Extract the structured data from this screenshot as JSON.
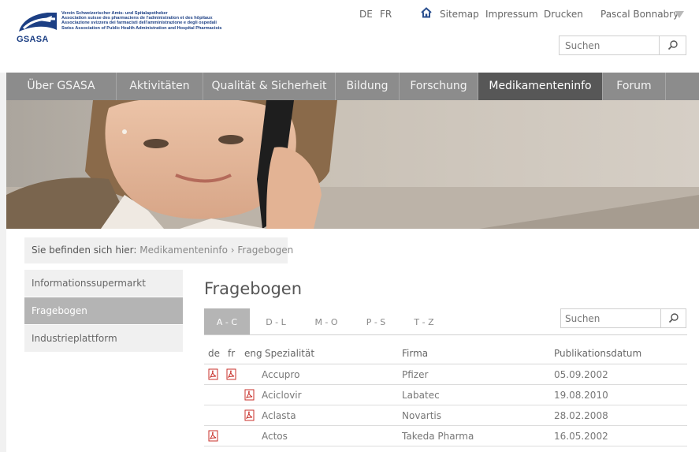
{
  "logo": {
    "lines": [
      "Verein Schweizerischer Amts- und Spitalapotheker",
      "Association suisse des pharmaciens de l'administration et des hôpitaux",
      "Associazione svizzera dei farmacisti dell'amministrazione e degli ospedali",
      "Swiss Association of Public Health Administration and Hospital Pharmacists"
    ],
    "acronym": "GSASA"
  },
  "header": {
    "lang_de": "DE",
    "lang_fr": "FR",
    "home_icon": "home-icon",
    "sitemap": "Sitemap",
    "impressum": "Impressum",
    "drucken": "Drucken",
    "user": "Pascal Bonnabry",
    "search_placeholder": "Suchen"
  },
  "nav": {
    "items": [
      "Über GSASA",
      "Aktivitäten",
      "Qualität & Sicherheit",
      "Bildung",
      "Forschung",
      "Medikamenteninfo",
      "Forum"
    ],
    "active": "Medikamenteninfo"
  },
  "breadcrumb": {
    "prefix": "Sie befinden sich hier:",
    "items": [
      "Medikamenteninfo",
      "Fragebogen"
    ],
    "separator": "›"
  },
  "sidebar": {
    "items": [
      "Informationssupermarkt",
      "Fragebogen",
      "Industrieplattform"
    ],
    "active": "Fragebogen"
  },
  "main": {
    "title": "Fragebogen",
    "tabs": [
      "A - C",
      "D - L",
      "M - O",
      "P - S",
      "T - Z"
    ],
    "active_tab": "A - C",
    "search_placeholder": "Suchen",
    "columns": [
      "de",
      "fr",
      "eng",
      "Spezialität",
      "Firma",
      "Publikationsdatum"
    ],
    "rows": [
      {
        "de": true,
        "fr": true,
        "eng": false,
        "name": "Accupro",
        "firma": "Pfizer",
        "date": "05.09.2002"
      },
      {
        "de": false,
        "fr": false,
        "eng": true,
        "name": "Aciclovir",
        "firma": "Labatec",
        "date": "19.08.2010"
      },
      {
        "de": false,
        "fr": false,
        "eng": true,
        "name": "Aclasta",
        "firma": "Novartis",
        "date": "28.02.2008"
      },
      {
        "de": true,
        "fr": false,
        "eng": false,
        "name": "Actos",
        "firma": "Takeda Pharma",
        "date": "16.05.2002"
      }
    ]
  },
  "colors": {
    "nav_bg": "#8c8c8c",
    "nav_active": "#575757",
    "brand_blue": "#1c3f84",
    "pdf_red": "#c8312b"
  }
}
